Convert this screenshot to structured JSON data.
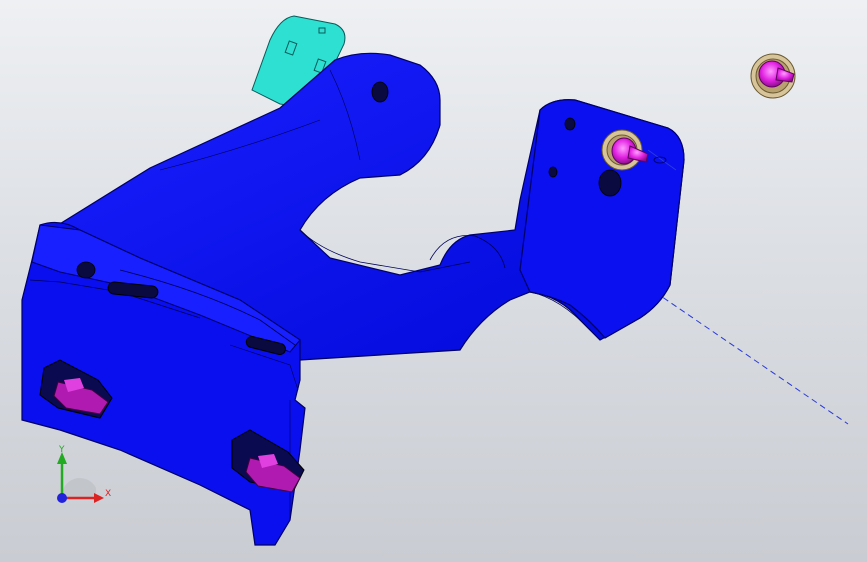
{
  "viewport": {
    "background_top": "#eef0f3",
    "background_bottom": "#c9ccd2"
  },
  "model": {
    "body_color": "#0a0ff0",
    "edge_color": "#000066",
    "clip_color": "#2ee0d2",
    "fastener_color": "#ee22ee",
    "washer_color": "#d8c49a",
    "centerline_color": "#2a3ad8"
  },
  "triad": {
    "y_label": "Y",
    "x_label": "X",
    "y_color": "#22aa22",
    "x_color": "#dd2222",
    "z_color": "#2222dd"
  }
}
